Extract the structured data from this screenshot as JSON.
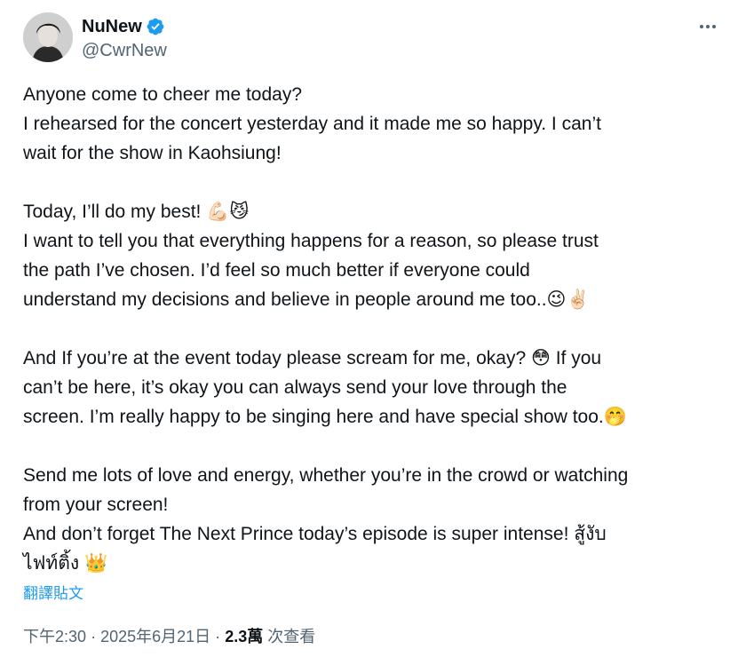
{
  "author": {
    "display_name": "NuNew",
    "handle": "@CwrNew",
    "verified": true,
    "verified_color": "#1d9bf0",
    "avatar_icon": "profile-photo"
  },
  "more_icon": "more-horizontal-icon",
  "tweet": {
    "lines": [
      "Anyone come to cheer me today?",
      "I rehearsed for the concert yesterday and it made me so happy. I can’t",
      "wait for the show in Kaohsiung!",
      "",
      "Today, I’ll do my best! 💪🏻😼",
      "I want to tell you that everything happens for a reason, so please trust",
      "the path I’ve chosen. I’d feel so much better if everyone could",
      "understand my decisions and believe in people around me too..😉✌🏻",
      "",
      "And If you’re at the event today please scream for me, okay? 😳 If you",
      "can’t be here, it’s okay you can always send your love through the",
      "screen. I’m really happy to be singing here and have special show too.🤭",
      "",
      "Send me lots of love and energy, whether you’re in the crowd or watching",
      "from your screen!",
      "And don’t forget The Next Prince today’s episode is super intense! สู้งับ",
      "ไฟท์ติ้ง 👑"
    ]
  },
  "translate_label": "翻譯貼文",
  "meta": {
    "time": "下午2:30",
    "sep1": "·",
    "date": "2025年6月21日",
    "sep2": "·",
    "views_count": "2.3萬",
    "views_label": "次查看"
  },
  "colors": {
    "text": "#0f1419",
    "secondary": "#536471",
    "link": "#1d9bf0"
  }
}
